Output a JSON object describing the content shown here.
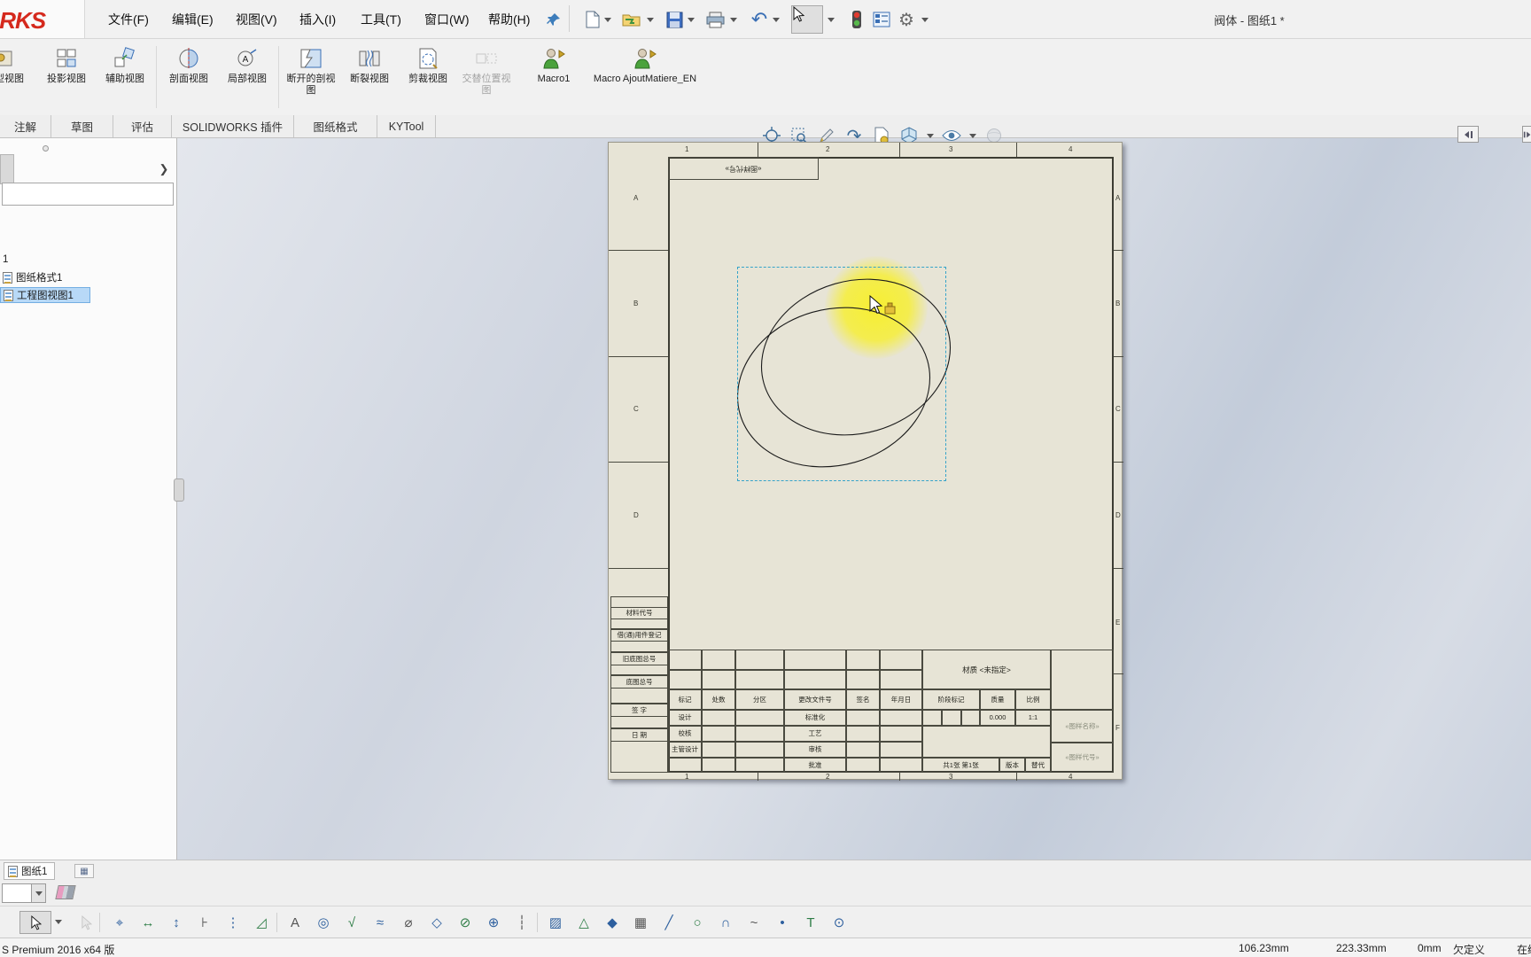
{
  "window": {
    "logo": "SOLIDWORKS",
    "title": "阀体 - 图纸1 *"
  },
  "menu": {
    "items": [
      "文件(F)",
      "编辑(E)",
      "视图(V)",
      "插入(I)",
      "工具(T)",
      "窗口(W)",
      "帮助(H)"
    ]
  },
  "command_manager": {
    "buttons": [
      "模型视图",
      "投影视图",
      "辅助视图",
      "剖面视图",
      "局部视图",
      "断开的剖视图",
      "断裂视图",
      "剪裁视图",
      "交替位置视图",
      "Macro1",
      "Macro AjoutMatiere_EN"
    ]
  },
  "tabs": {
    "items": [
      "注解",
      "草图",
      "评估",
      "SOLIDWORKS 插件",
      "图纸格式",
      "KYTool"
    ]
  },
  "feature_tree": {
    "root_partial": "1",
    "item_sheet_format": "图纸格式1",
    "item_drawing_view": "工程图视图1"
  },
  "sheet": {
    "note_top_left": "«图样代号»",
    "zones_h": [
      "1",
      "2",
      "3",
      "4"
    ],
    "zones_v": [
      "A",
      "B",
      "C",
      "D",
      "E",
      "F"
    ],
    "attached": [
      "材料代号",
      "借(通)用件登记",
      "旧底图总号",
      "底图总号",
      "签 字",
      "日 期"
    ],
    "revision_header": [
      "标记",
      "处数",
      "分区",
      "更改文件号",
      "签名",
      "年月日"
    ],
    "sign_rows": [
      [
        "设计",
        "标准化"
      ],
      [
        "校核",
        "工艺"
      ],
      [
        "主管设计",
        "审核"
      ],
      [
        "",
        "批准"
      ]
    ],
    "material": "材质 <未指定>",
    "stage_header": [
      "阶段标记",
      "质量",
      "比例"
    ],
    "mass": "0.000",
    "scale": "1:1",
    "sheet_count": "共1张 第1张",
    "version_label": "版本",
    "substitute_label": "替代",
    "name_placeholder": "«图样名称»",
    "code_placeholder": "«图样代号»"
  },
  "sheet_tabs": {
    "active": "图纸1"
  },
  "bottom_toolbar": {
    "icons": [
      {
        "name": "smart-dimension",
        "glyph": "⌖"
      },
      {
        "name": "horizontal-dimension",
        "glyph": "↔"
      },
      {
        "name": "vertical-dimension",
        "glyph": "↕"
      },
      {
        "name": "baseline-dimension",
        "glyph": "⊦"
      },
      {
        "name": "ordinate-dimension",
        "glyph": "⋮"
      },
      {
        "name": "chamfer-dimension",
        "glyph": "◿"
      },
      {
        "name": "note",
        "glyph": "A"
      },
      {
        "name": "balloon",
        "glyph": "◎"
      },
      {
        "name": "surface-finish",
        "glyph": "√"
      },
      {
        "name": "weld-symbol",
        "glyph": "≈"
      },
      {
        "name": "geometric-tolerance",
        "glyph": "⌀"
      },
      {
        "name": "datum-feature",
        "glyph": "◇"
      },
      {
        "name": "hole-callout",
        "glyph": "⊘"
      },
      {
        "name": "center-mark",
        "glyph": "⊕"
      },
      {
        "name": "centerline",
        "glyph": "┆"
      },
      {
        "name": "area-hatch",
        "glyph": "▨"
      },
      {
        "name": "revision-symbol",
        "glyph": "△"
      },
      {
        "name": "block",
        "glyph": "◆"
      },
      {
        "name": "table",
        "glyph": "▦"
      },
      {
        "name": "sketch-line",
        "glyph": "╱"
      },
      {
        "name": "sketch-circle",
        "glyph": "○"
      },
      {
        "name": "sketch-arc",
        "glyph": "∩"
      },
      {
        "name": "sketch-spline",
        "glyph": "~"
      },
      {
        "name": "sketch-point",
        "glyph": "•"
      },
      {
        "name": "sketch-text",
        "glyph": "T"
      },
      {
        "name": "magnifying-glass",
        "glyph": "⊙"
      }
    ]
  },
  "status_bar": {
    "left": "S Premium 2016 x64 版",
    "x": "106.23mm",
    "y": "223.33mm",
    "z": "0mm",
    "state": "欠定义",
    "editing": "在编辑"
  }
}
